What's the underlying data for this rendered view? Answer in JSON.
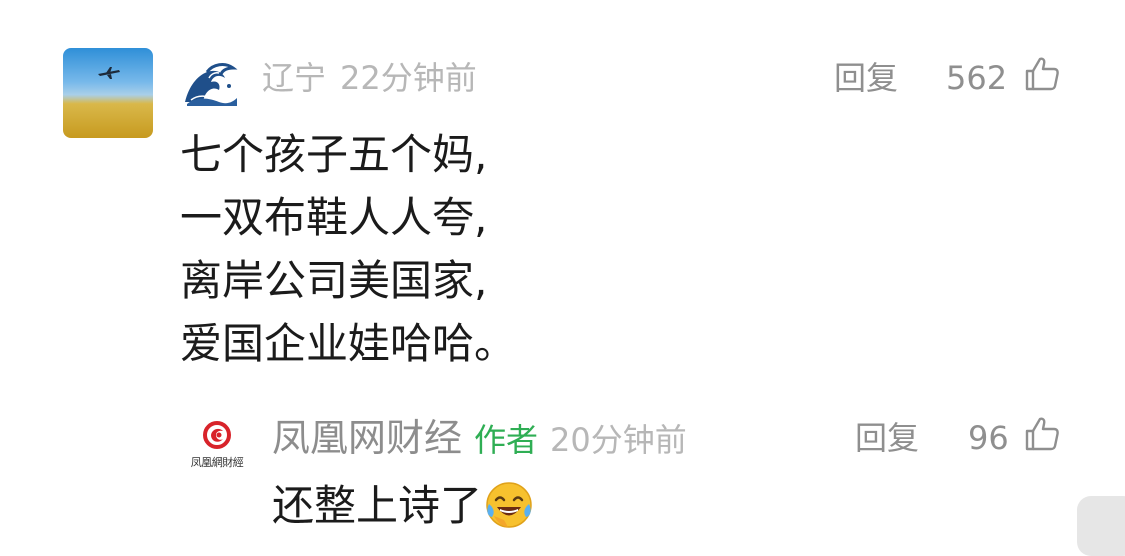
{
  "comment": {
    "location": "辽宁",
    "time": "22分钟前",
    "reply_label": "回复",
    "likes": "562",
    "lines": [
      "七个孩子五个妈,",
      "一双布鞋人人夸,",
      "离岸公司美国家,",
      "爱国企业娃哈哈。"
    ]
  },
  "author_reply": {
    "name": "凤凰网财经",
    "badge": "作者",
    "time": "20分钟前",
    "reply_label": "回复",
    "likes": "96",
    "logo_text": "凤凰網財經",
    "text": "还整上诗了",
    "emoji": "face-with-tears-of-joy-icon"
  },
  "colors": {
    "meta_gray": "#b7b7b7",
    "action_gray": "#8f8f8f",
    "author_badge_green": "#2fae54",
    "text": "#1b1b1b"
  }
}
